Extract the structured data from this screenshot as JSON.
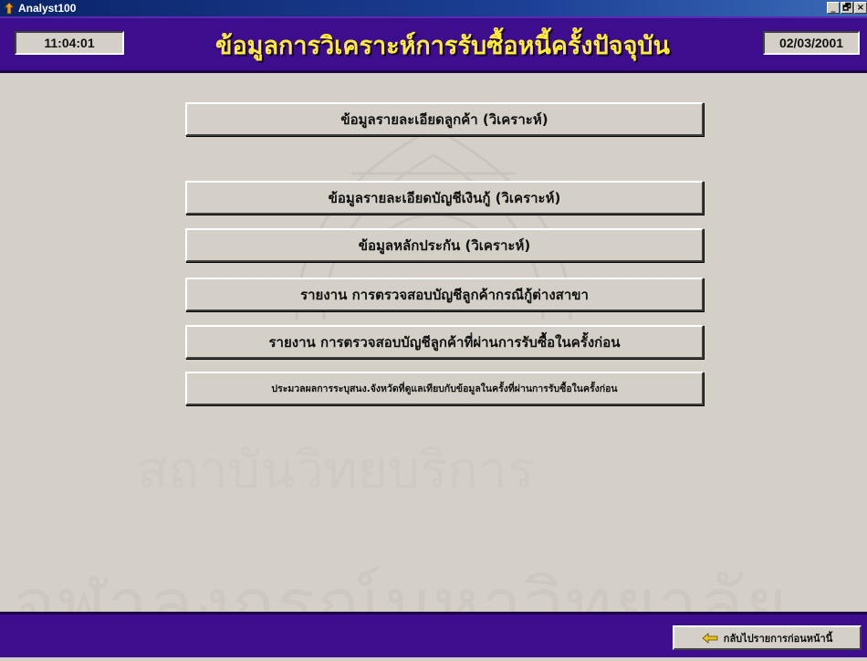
{
  "window": {
    "title": "Analyst100",
    "controls": {
      "minimize": "_",
      "restore": "🗗",
      "close": "×"
    }
  },
  "header": {
    "time": "11:04:01",
    "title": "ข้อมูลการวิเคราะห์การรับซื้อหนี้ครั้งปัจจุบัน",
    "date": "02/03/2001"
  },
  "menu": {
    "items": [
      {
        "label": "ข้อมูลรายละเอียดลูกค้า (วิเคราะห์)"
      },
      {
        "label": "ข้อมูลรายละเอียดบัญชีเงินกู้ (วิเคราะห์)"
      },
      {
        "label": "ข้อมูลหลักประกัน (วิเคราะห์)"
      },
      {
        "label": "รายงาน การตรวจสอบบัญชีลูกค้ากรณีกู้ต่างสาขา"
      },
      {
        "label": "รายงาน การตรวจสอบบัญชีลูกค้าที่ผ่านการรับซื้อในครั้งก่อน"
      },
      {
        "label": "ประมวลผลการระบุสนง.จังหวัดที่ดูแลเทียบกับข้อมูลในครั้งที่ผ่านการรับซื้อในครั้งก่อน"
      }
    ]
  },
  "watermark": {
    "line1": "สถาบันวิทยบริการ",
    "line2": "จุฬาลงกรณ์มหาวิทยาลัย"
  },
  "footer": {
    "back_label": "กลับไปรายการก่อนหน้านี้",
    "back_icon": "back-arrow-icon"
  },
  "colors": {
    "header_bg": "#3c0d8c",
    "title_text": "#ffeb3b",
    "face": "#d4d0c8",
    "titlebar": "#0a2468"
  }
}
